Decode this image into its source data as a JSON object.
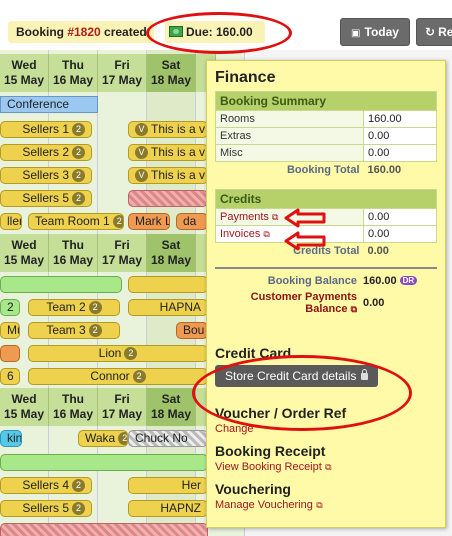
{
  "topbar": {
    "booking_prefix": "Booking ",
    "booking_number": "#1820",
    "booking_suffix": " created",
    "due_label": "Due: 160.00",
    "today_label": "Today",
    "refresh_label": "Re"
  },
  "calendar": {
    "header_rows": [
      [
        {
          "day": "Wed",
          "date": "15 May"
        },
        {
          "day": "Thu",
          "date": "16 May"
        },
        {
          "day": "Fri",
          "date": "17 May"
        },
        {
          "day": "Sat",
          "date": "18 May"
        }
      ],
      [
        {
          "day": "Wed",
          "date": "15 May"
        },
        {
          "day": "Thu",
          "date": "16 May"
        },
        {
          "day": "Fri",
          "date": "17 May"
        },
        {
          "day": "Sat",
          "date": "18 May"
        }
      ],
      [
        {
          "day": "Wed",
          "date": "15 May"
        },
        {
          "day": "Thu",
          "date": "16 May"
        },
        {
          "day": "Fri",
          "date": "17 May"
        },
        {
          "day": "Sat",
          "date": "18 May"
        }
      ]
    ],
    "bookings": {
      "conference": "Conference",
      "sellers1": "Sellers 1",
      "sellers1_count": "2",
      "sellers2": "Sellers 2",
      "sellers2_count": "2",
      "sellers3": "Sellers 3",
      "sellers3_count": "2",
      "sellers5": "Sellers 5",
      "sellers5_count": "2",
      "this_is_a": "This is a v",
      "v_icon": "V",
      "sellers_trunc": "llers",
      "team_room1": "Team Room 1",
      "team_room1_count": "2",
      "mark_l": "Mark Lu",
      "da": "da",
      "team2": "Team 2",
      "team2_count": "2",
      "team3": "Team 3",
      "team3_count": "2",
      "hapn": "HAPNA",
      "mull": "Müll",
      "bou": "Bou",
      "lion": "Lion",
      "lion_count": "2",
      "connor": "Connor",
      "connor_count": "2",
      "king": "king",
      "waka": "Waka",
      "waka_count": "2",
      "chuck": "Chuck No",
      "sellers4": "Sellers 4",
      "sellers4_count": "2",
      "her": "Her",
      "sellers5b": "Sellers 5",
      "sellers5b_count": "2",
      "hapnz": "HAPNZ",
      "count_2": "2",
      "count_6": "6"
    }
  },
  "finance": {
    "title": "Finance",
    "summary_heading": "Booking Summary",
    "summary_rows": [
      {
        "label": "Rooms",
        "value": "160.00"
      },
      {
        "label": "Extras",
        "value": "0.00"
      },
      {
        "label": "Misc",
        "value": "0.00"
      }
    ],
    "booking_total_label": "Booking Total",
    "booking_total_value": "160.00",
    "credits_heading": "Credits",
    "payments_label": "Payments",
    "payments_value": "0.00",
    "invoices_label": "Invoices",
    "invoices_value": "0.00",
    "credits_total_label": "Credits Total",
    "credits_total_value": "0.00",
    "balance_label": "Booking Balance",
    "balance_value": "160.00",
    "balance_badge": "DR",
    "cust_payments_label_1": "Customer Payments",
    "cust_payments_label_2": "Balance",
    "cust_payments_value": "0.00",
    "credit_card_heading": "Credit Card",
    "credit_card_button": "Store Credit Card details",
    "voucher_heading": "Voucher / Order Ref",
    "voucher_link": "Change",
    "receipt_heading": "Booking Receipt",
    "receipt_link": "View Booking Receipt",
    "vouchering_heading": "Vouchering",
    "vouchering_link": "Manage Vouchering"
  },
  "colors": {
    "annotation_red": "#e01010",
    "finance_bg": "#fffaa8",
    "header_green": "#c5de98"
  }
}
